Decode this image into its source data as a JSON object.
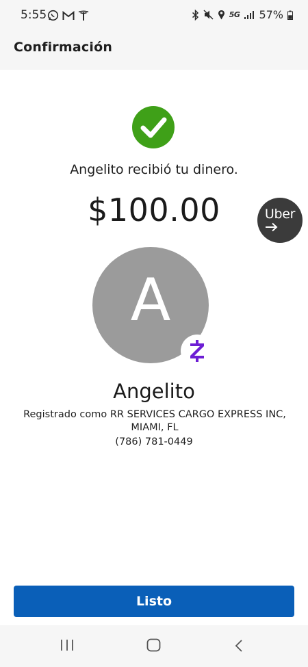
{
  "status_bar": {
    "time": "5:55",
    "network": "5G",
    "battery": "57%"
  },
  "header": {
    "title": "Confirmación"
  },
  "confirmation": {
    "message": "Angelito recibió tu dinero.",
    "amount": "$100.00",
    "success_color": "#3fa018"
  },
  "uber_bubble": {
    "label": "Uber"
  },
  "recipient": {
    "initial": "A",
    "name": "Angelito",
    "registered_as": "Registrado como RR SERVICES CARGO EXPRESS INC, MIAMI, FL",
    "phone": "(786) 781-0449",
    "badge_icon": "zelle-icon",
    "badge_color": "#6d1ed4"
  },
  "actions": {
    "done_label": "Listo",
    "button_color": "#0a5fb8"
  }
}
